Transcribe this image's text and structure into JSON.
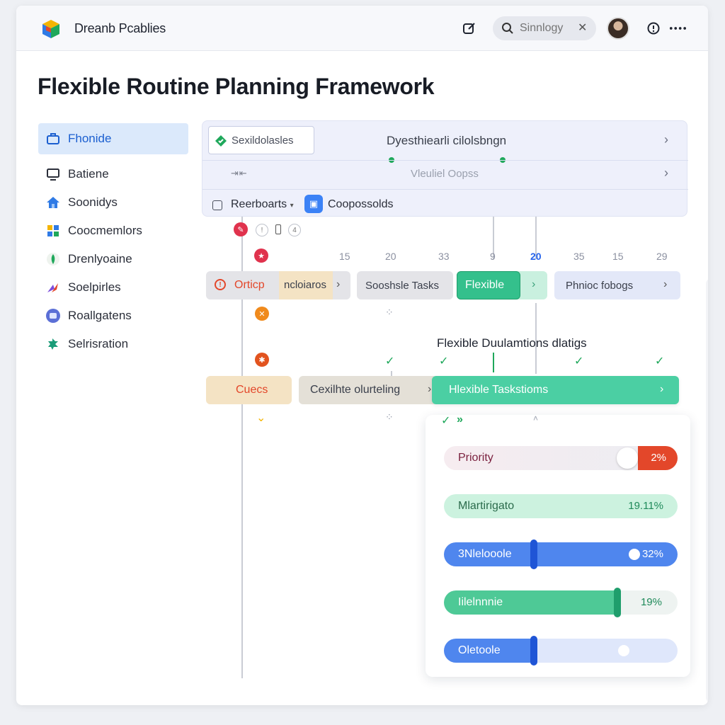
{
  "app": {
    "name": "Dreanb Pcablies"
  },
  "search": {
    "placeholder": "Sinnlogy"
  },
  "page": {
    "title": "Flexible Routine Planning Framework"
  },
  "sidebar": {
    "items": [
      {
        "label": "Fhonide",
        "icon": "briefcase-icon",
        "active": true
      },
      {
        "label": "Batiene",
        "icon": "monitor-icon"
      },
      {
        "label": "Soonidys",
        "icon": "home-icon"
      },
      {
        "label": "Coocmemlors",
        "icon": "grid-icon"
      },
      {
        "label": "Drenlyoaine",
        "icon": "leaf-icon"
      },
      {
        "label": "Soelpirles",
        "icon": "sparkle-icon"
      },
      {
        "label": "Roallgatens",
        "icon": "badge-icon"
      },
      {
        "label": "Selrisration",
        "icon": "puzzle-icon"
      }
    ]
  },
  "header": {
    "tag": "Sexildolasles",
    "title": "Dyesthiearli cilolsbngn",
    "subtitle": "Vleuliel Oopss",
    "filter_label": "Reerboarts",
    "chip_label": "Coopossolds"
  },
  "timeline": {
    "ticks": [
      "15",
      "20",
      "33",
      "9",
      "20",
      "35",
      "15",
      "29"
    ],
    "active_tick_index": 4,
    "mini_icons": [
      "!",
      "?",
      "4"
    ]
  },
  "rows": {
    "row1": {
      "pill1_label": "Orticp",
      "pill1b_label": "ncloiaros",
      "pill2_label": "Sooshsle Tasks",
      "pill3_label": "Flexible",
      "pill4_label": "Phnioc fobogs"
    },
    "caption": "Flexible Duulamtions dlatigs",
    "row2": {
      "pill1_label": "Cuecs",
      "pill2_label": "Cexilhte olurteling",
      "pill3_label": "Hlexible Taskstioms"
    }
  },
  "sliders": [
    {
      "label": "Priority",
      "value": "2%",
      "level": 0.78
    },
    {
      "label": "Mlartirigato",
      "value": "19.11%",
      "level": 1.0
    },
    {
      "label": "3Nlelooole",
      "value": "32%",
      "level": 0.38
    },
    {
      "label": "Iilelnnnie",
      "value": "19%",
      "level": 0.74
    },
    {
      "label": "Oletoole",
      "value": "",
      "level": 0.38
    }
  ],
  "colors": {
    "accent_blue": "#3b82f6",
    "accent_green": "#34c08c",
    "accent_red": "#e3472a",
    "warm_beige": "#f4e3c4",
    "neutral_gray": "#e4e4e8"
  }
}
